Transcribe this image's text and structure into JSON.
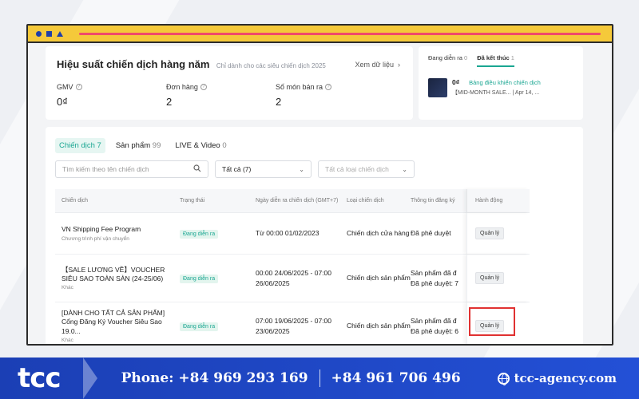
{
  "performance": {
    "title": "Hiệu suất chiến dịch hàng năm",
    "subtitle": "Chỉ dành cho các siêu chiến dịch 2025",
    "view_link": "Xem dữ liệu",
    "metrics": [
      {
        "label": "GMV",
        "value": "0₫"
      },
      {
        "label": "Đơn hàng",
        "value": "2"
      },
      {
        "label": "Số món bán ra",
        "value": "2"
      }
    ]
  },
  "right_card": {
    "tabs": [
      {
        "label": "Đang diễn ra",
        "count": "0"
      },
      {
        "label": "Đã kết thúc",
        "count": "1"
      }
    ],
    "item": {
      "value": "0₫",
      "link": "Bảng điều khiển chiến dịch",
      "meta": "【MID-MONTH SALE...  |  Apr 14, ..."
    }
  },
  "tabs": [
    {
      "label": "Chiến dịch",
      "count": "7"
    },
    {
      "label": "Sản phẩm",
      "count": "99"
    },
    {
      "label": "LIVE & Video",
      "count": "0"
    }
  ],
  "filters": {
    "search_placeholder": "Tìm kiếm theo tên chiến dịch",
    "status_select": "Tất cả (7)",
    "type_select": "Tất cả loại chiến dịch"
  },
  "table": {
    "headers": [
      "Chiến dịch",
      "Trạng thái",
      "Ngày diễn ra chiến dịch (GMT+7)",
      "Loại chiến dịch",
      "Thông tin đăng ký",
      "Hành động"
    ],
    "rows": [
      {
        "name": "VN Shipping Fee Program",
        "sub": "Chương trình phí vận chuyển",
        "status": "Đang diễn ra",
        "date": "Từ 00:00 01/02/2023",
        "type": "Chiến dịch cửa hàng",
        "reg": "Đã phê duyệt",
        "action": "Quản lý"
      },
      {
        "name": "【SALE LƯƠNG VỀ】VOUCHER SIÊU SAO TOÀN SÀN (24-25/06)",
        "sub": "Khác",
        "status": "Đang diễn ra",
        "date": "00:00 24/06/2025 - 07:00 26/06/2025",
        "type": "Chiến dịch sản phẩm",
        "reg": "Sản phẩm đã đ Đã phê duyệt: 7",
        "action": "Quản lý"
      },
      {
        "name": "[DÀNH CHO TẤT CẢ SẢN PHẨM] Cổng Đăng Ký Voucher Siêu Sao 19.0...",
        "sub": "Khác",
        "status": "Đang diễn ra",
        "date": "07:00 19/06/2025 - 07:00 23/06/2025",
        "type": "Chiến dịch sản phẩm",
        "reg": "Sản phẩm đã đ Đã phê duyệt: 6",
        "action": "Quản lý"
      }
    ]
  },
  "footer": {
    "logo": "tcc",
    "phone1": "Phone: +84 969 293 169",
    "phone2": "+84 961 706 496",
    "website": "tcc-agency.com"
  },
  "colors": {
    "accent": "#1aa692",
    "frame_bar": "#f5c93a",
    "footer_blue": "#2350d6",
    "highlight": "#e03131"
  }
}
